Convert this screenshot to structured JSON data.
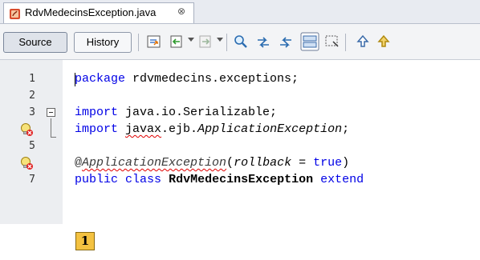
{
  "tab": {
    "title": "RdvMedecinsException.java",
    "close_glyph": "⊗"
  },
  "toolbar": {
    "source_label": "Source",
    "history_label": "History",
    "icons": [
      "goto-source-icon",
      "back-icon",
      "forward-icon",
      "find-icon",
      "previous-occurrence-icon",
      "next-occurrence-icon",
      "toggle-highlight-icon",
      "toggle-rectangular-selection-icon",
      "previous-bookmark-icon",
      "next-bookmark-icon"
    ]
  },
  "editor": {
    "lines": [
      {
        "number": "1",
        "text": "package rdvmedecins.exceptions;"
      },
      {
        "number": "2",
        "text": ""
      },
      {
        "number": "3",
        "text": "import java.io.Serializable;"
      },
      {
        "number": "",
        "text": "import javax.ejb.ApplicationException;",
        "marker": "warning-lightbulb-icon"
      },
      {
        "number": "5",
        "text": ""
      },
      {
        "number": "",
        "text": "@ApplicationException(rollback = true)",
        "marker": "warning-lightbulb-icon"
      },
      {
        "number": "7",
        "text": "public class RdvMedecinsException extend"
      },
      {
        "number": "",
        "text": ""
      }
    ],
    "tokens": {
      "l1_kw": "package",
      "l1_rest": " rdvmedecins.exceptions;",
      "l3_kw": "import",
      "l3_rest": " java.io.Serializable;",
      "l4_kw": "import",
      "l4_sp": " ",
      "l4_sq": "javax",
      "l4_mid": ".ejb.",
      "l4_cls": "ApplicationException",
      "l4_end": ";",
      "l6_at": "@",
      "l6_anno": "ApplicationException",
      "l6_p1": "(",
      "l6_param": "rollback",
      "l6_eq": " = ",
      "l6_true": "true",
      "l6_p2": ")",
      "l7_kw1": "public",
      "l7_sp1": " ",
      "l7_kw2": "class",
      "l7_sp2": " ",
      "l7_name": "RdvMedecinsException",
      "l7_sp3": " ",
      "l7_kw3": "extend"
    }
  },
  "badge": {
    "label": "1"
  },
  "colors": {
    "keyword": "#0000e6",
    "gutter": "#eceef1",
    "error_underline": "#e00000",
    "badge": "#f4c241"
  }
}
